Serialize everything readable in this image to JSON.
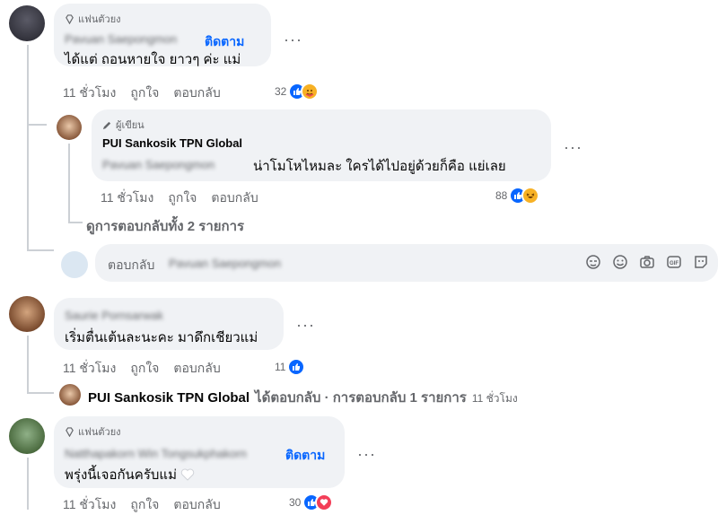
{
  "fan_badge": "แฟนตัวยง",
  "author_badge": "ผู้เขียน",
  "follow_label": "ติดตาม",
  "time": "11 ชั่วโมง",
  "like_label": "ถูกใจ",
  "reply_label": "ตอบกลับ",
  "comments": [
    {
      "blurred_name": "Pavuan Saepongmon",
      "text": "ได้แต่ ถอนหายใจ ยาวๆ ค่ะ แม่",
      "reaction_count": "32"
    },
    {
      "blurred_name": "Saurie Pornsarwak",
      "text": "เริ่มตื่นเต้นละนะคะ มาดึกเชียวแม่",
      "reaction_count": "11"
    },
    {
      "blurred_name": "Natthapakorn Win Tongsukphakorn",
      "text": "พรุ่งนี้เจอกันครับแม่",
      "reaction_count": "30"
    }
  ],
  "author_reply": {
    "name": "PUI Sankosik TPN Global",
    "blurred_mention": "Pavuan Saepongmon",
    "text": "น่าโมโหไหมละ ใครได้ไปอยู่ด้วยก็คือ แย่เลย",
    "reaction_count": "88"
  },
  "view_all_replies": "ดูการตอบกลับทั้ง 2 รายการ",
  "reply_input": {
    "prefix": "ตอบกลับ",
    "blurred_name": "Pavuan Saepongmon"
  },
  "collapsed_reply": {
    "name": "PUI Sankosik TPN Global",
    "summary": "ได้ตอบกลับ · การตอบกลับ 1 รายการ",
    "time": "11 ชั่วโมง"
  },
  "icons": [
    "diamond-icon",
    "pencil-icon",
    "like-reaction-icon",
    "love-reaction-icon",
    "haha-reaction-icon",
    "care-reaction-icon",
    "sticker-icon",
    "smile-icon",
    "camera-icon",
    "gif-icon",
    "emoji-face-icon"
  ],
  "colors": {
    "link": "#0866ff",
    "like": "#0866ff",
    "love": "#f33e58",
    "bubble": "#f0f2f5",
    "muted": "#65676b"
  }
}
